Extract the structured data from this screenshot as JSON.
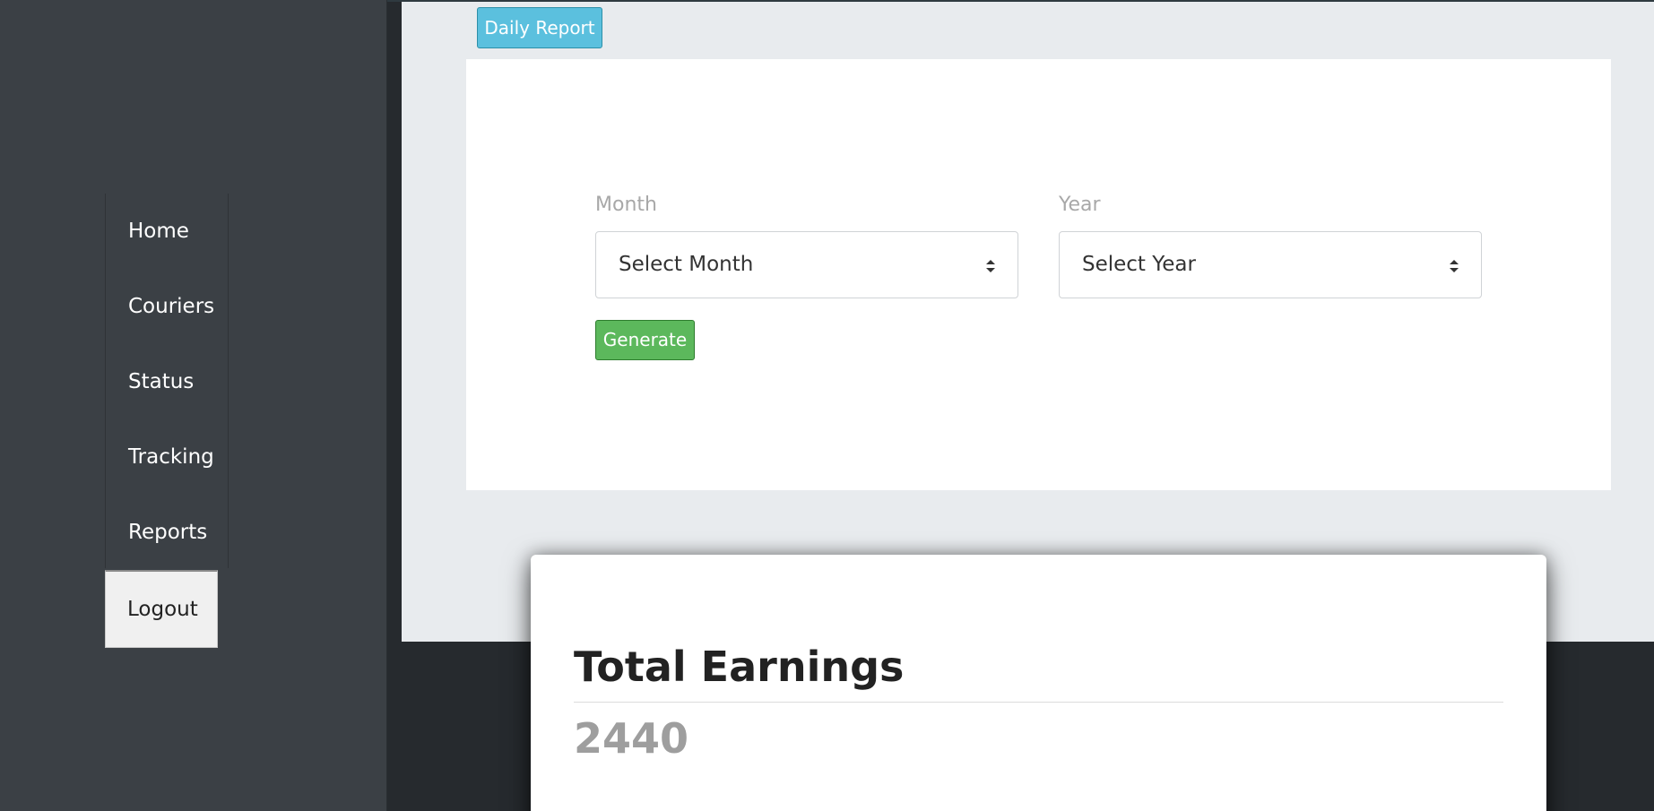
{
  "sidebar": {
    "items": [
      {
        "label": "Home"
      },
      {
        "label": "Couriers"
      },
      {
        "label": "Status"
      },
      {
        "label": "Tracking"
      },
      {
        "label": "Reports"
      }
    ],
    "logout_label": "Logout"
  },
  "toolbar": {
    "daily_report_label": "Daily Report"
  },
  "report_form": {
    "month_label": "Month",
    "month_value": "Select Month",
    "year_label": "Year",
    "year_value": "Select Year",
    "generate_label": "Generate"
  },
  "earnings": {
    "title": "Total Earnings",
    "value": "2440"
  },
  "colors": {
    "sidebar_bg": "#3b4045",
    "main_bg": "#e8ebee",
    "info_button": "#5bc0de",
    "success_button": "#5cb85c"
  }
}
